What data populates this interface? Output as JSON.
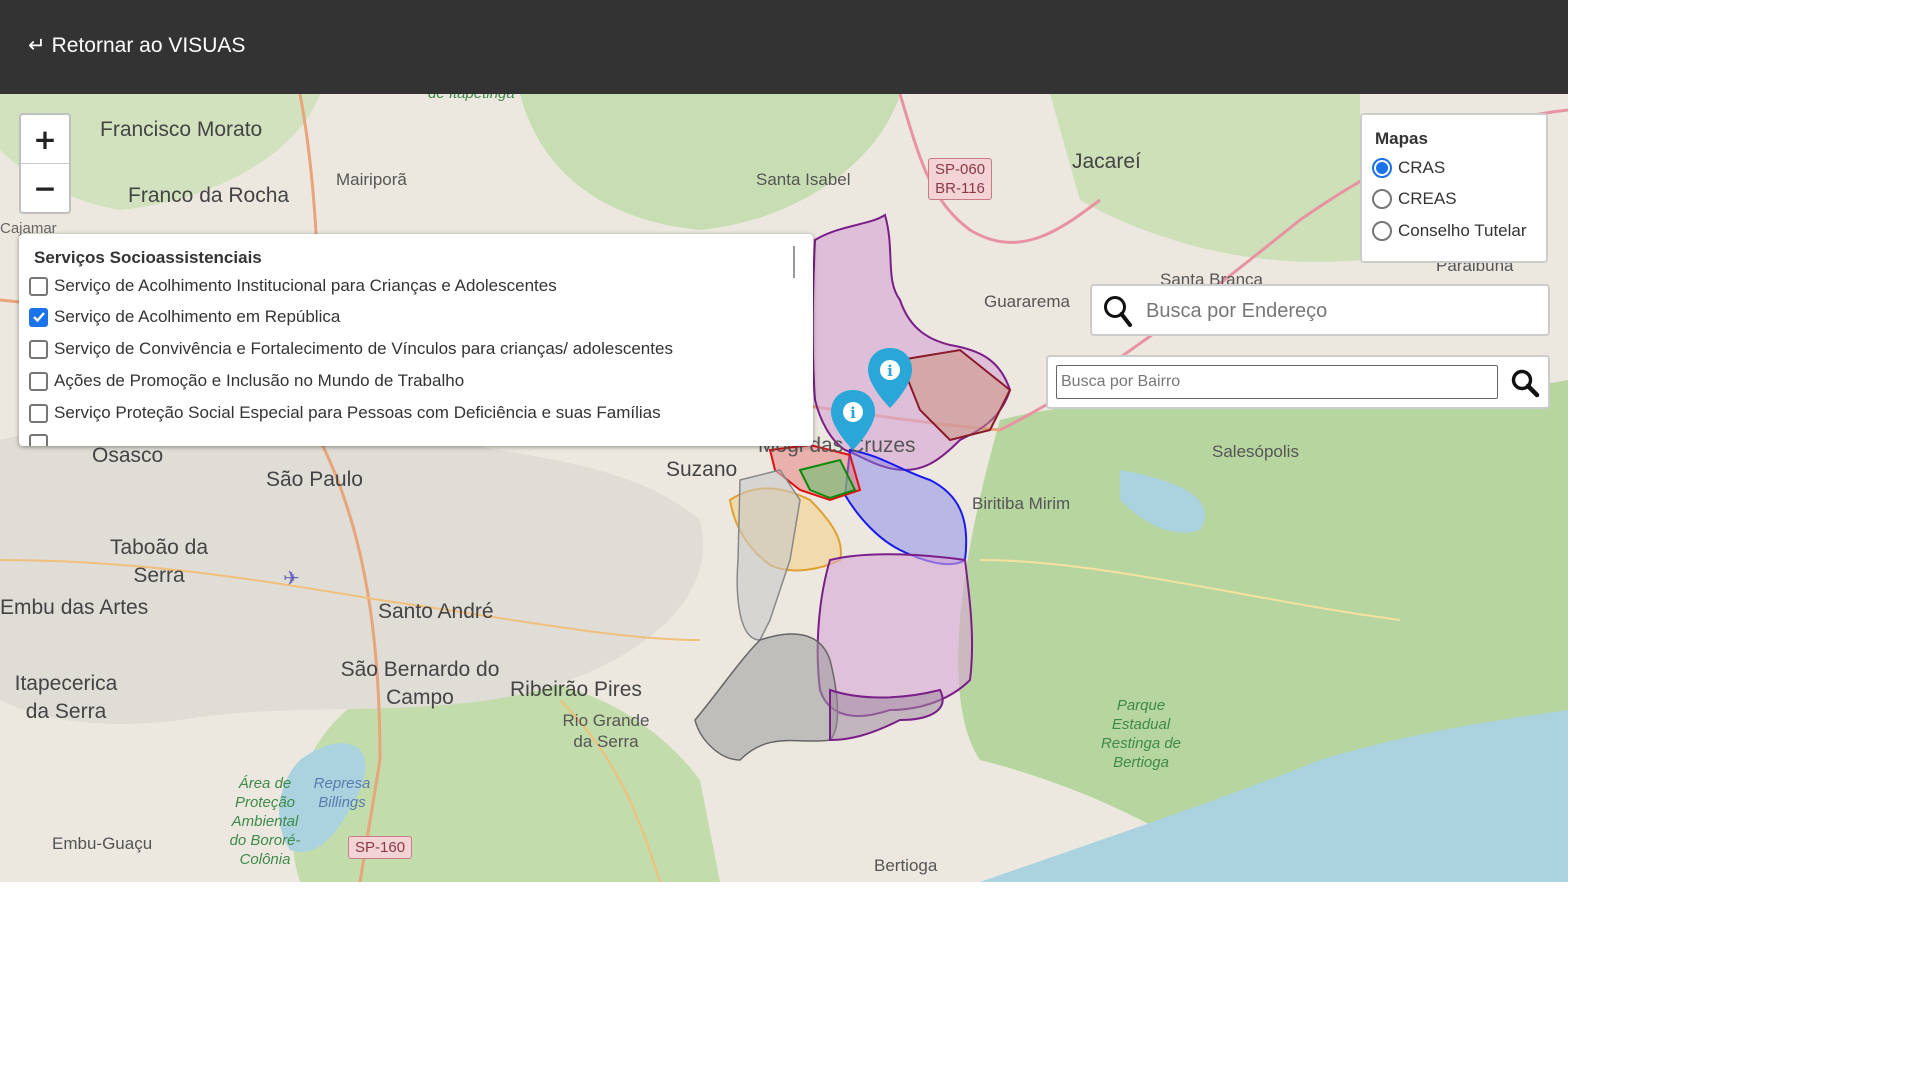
{
  "header": {
    "back_arrow": "↵",
    "back_label": "Retornar ao VISUAS"
  },
  "zoom": {
    "in_label": "+",
    "out_label": "−"
  },
  "services_panel": {
    "title": "Serviços Socioassistenciais",
    "items": [
      {
        "label": "Serviço de Acolhimento Institucional para Crianças e Adolescentes",
        "checked": false
      },
      {
        "label": "Serviço de Acolhimento em República",
        "checked": true
      },
      {
        "label": "Serviço de Convivência e Fortalecimento de Vínculos para crianças/ adolescentes",
        "checked": false
      },
      {
        "label": "Ações de Promoção e Inclusão no Mundo de Trabalho",
        "checked": false
      },
      {
        "label": "Serviço Proteção Social Especial para Pessoas com Deficiência e suas Famílias",
        "checked": false
      }
    ]
  },
  "maps_panel": {
    "title": "Mapas",
    "options": [
      {
        "label": "CRAS",
        "selected": true
      },
      {
        "label": "CREAS",
        "selected": false
      },
      {
        "label": "Conselho Tutelar",
        "selected": false
      }
    ]
  },
  "search_address": {
    "placeholder": "Busca por Endereço",
    "icon": "search-icon"
  },
  "search_bairro": {
    "placeholder": "Busca por Bairro",
    "icon": "search-icon"
  },
  "map_labels": {
    "francisco_morato": "Francisco Morato",
    "franco_da_rocha": "Franco da Rocha",
    "mairipora": "Mairiporã",
    "cajamar": "Cajamar",
    "santa_isabel": "Santa Isabel",
    "jacarei": "Jacareí",
    "santa_branca": "Santa Branca",
    "paraibuna": "Paraibuna",
    "guararema": "Guararema",
    "osasco": "Osasco",
    "sao_paulo": "São Paulo",
    "suzano": "Suzano",
    "mogi": "Mogi das Cruzes",
    "salesopolis": "Salesópolis",
    "biritiba": "Biritiba Mirim",
    "taboao": "Taboão da Serra",
    "embu": "Embu das Artes",
    "santo_andre": "Santo André",
    "sao_bernardo": "São Bernardo do Campo",
    "ribeirao_pires": "Ribeirão Pires",
    "itapecerica": "Itapecerica da Serra",
    "rio_grande": "Rio Grande da Serra",
    "embu_guacu": "Embu-Guaçu",
    "bertioga": "Bertioga",
    "itapetinga": "de Itapetinga",
    "represa": "Represa Billings",
    "area_protecao": "Área de Proteção Ambiental do Bororé-Colônia",
    "parque": "Parque Estadual Restinga de Bertioga",
    "shield_sp060": "SP-060",
    "shield_br116": "BR-116",
    "shield_sp160": "SP-160"
  },
  "colors": {
    "header_bg": "#333333",
    "accent": "#1a73e8",
    "pin": "#2aa7d8"
  }
}
